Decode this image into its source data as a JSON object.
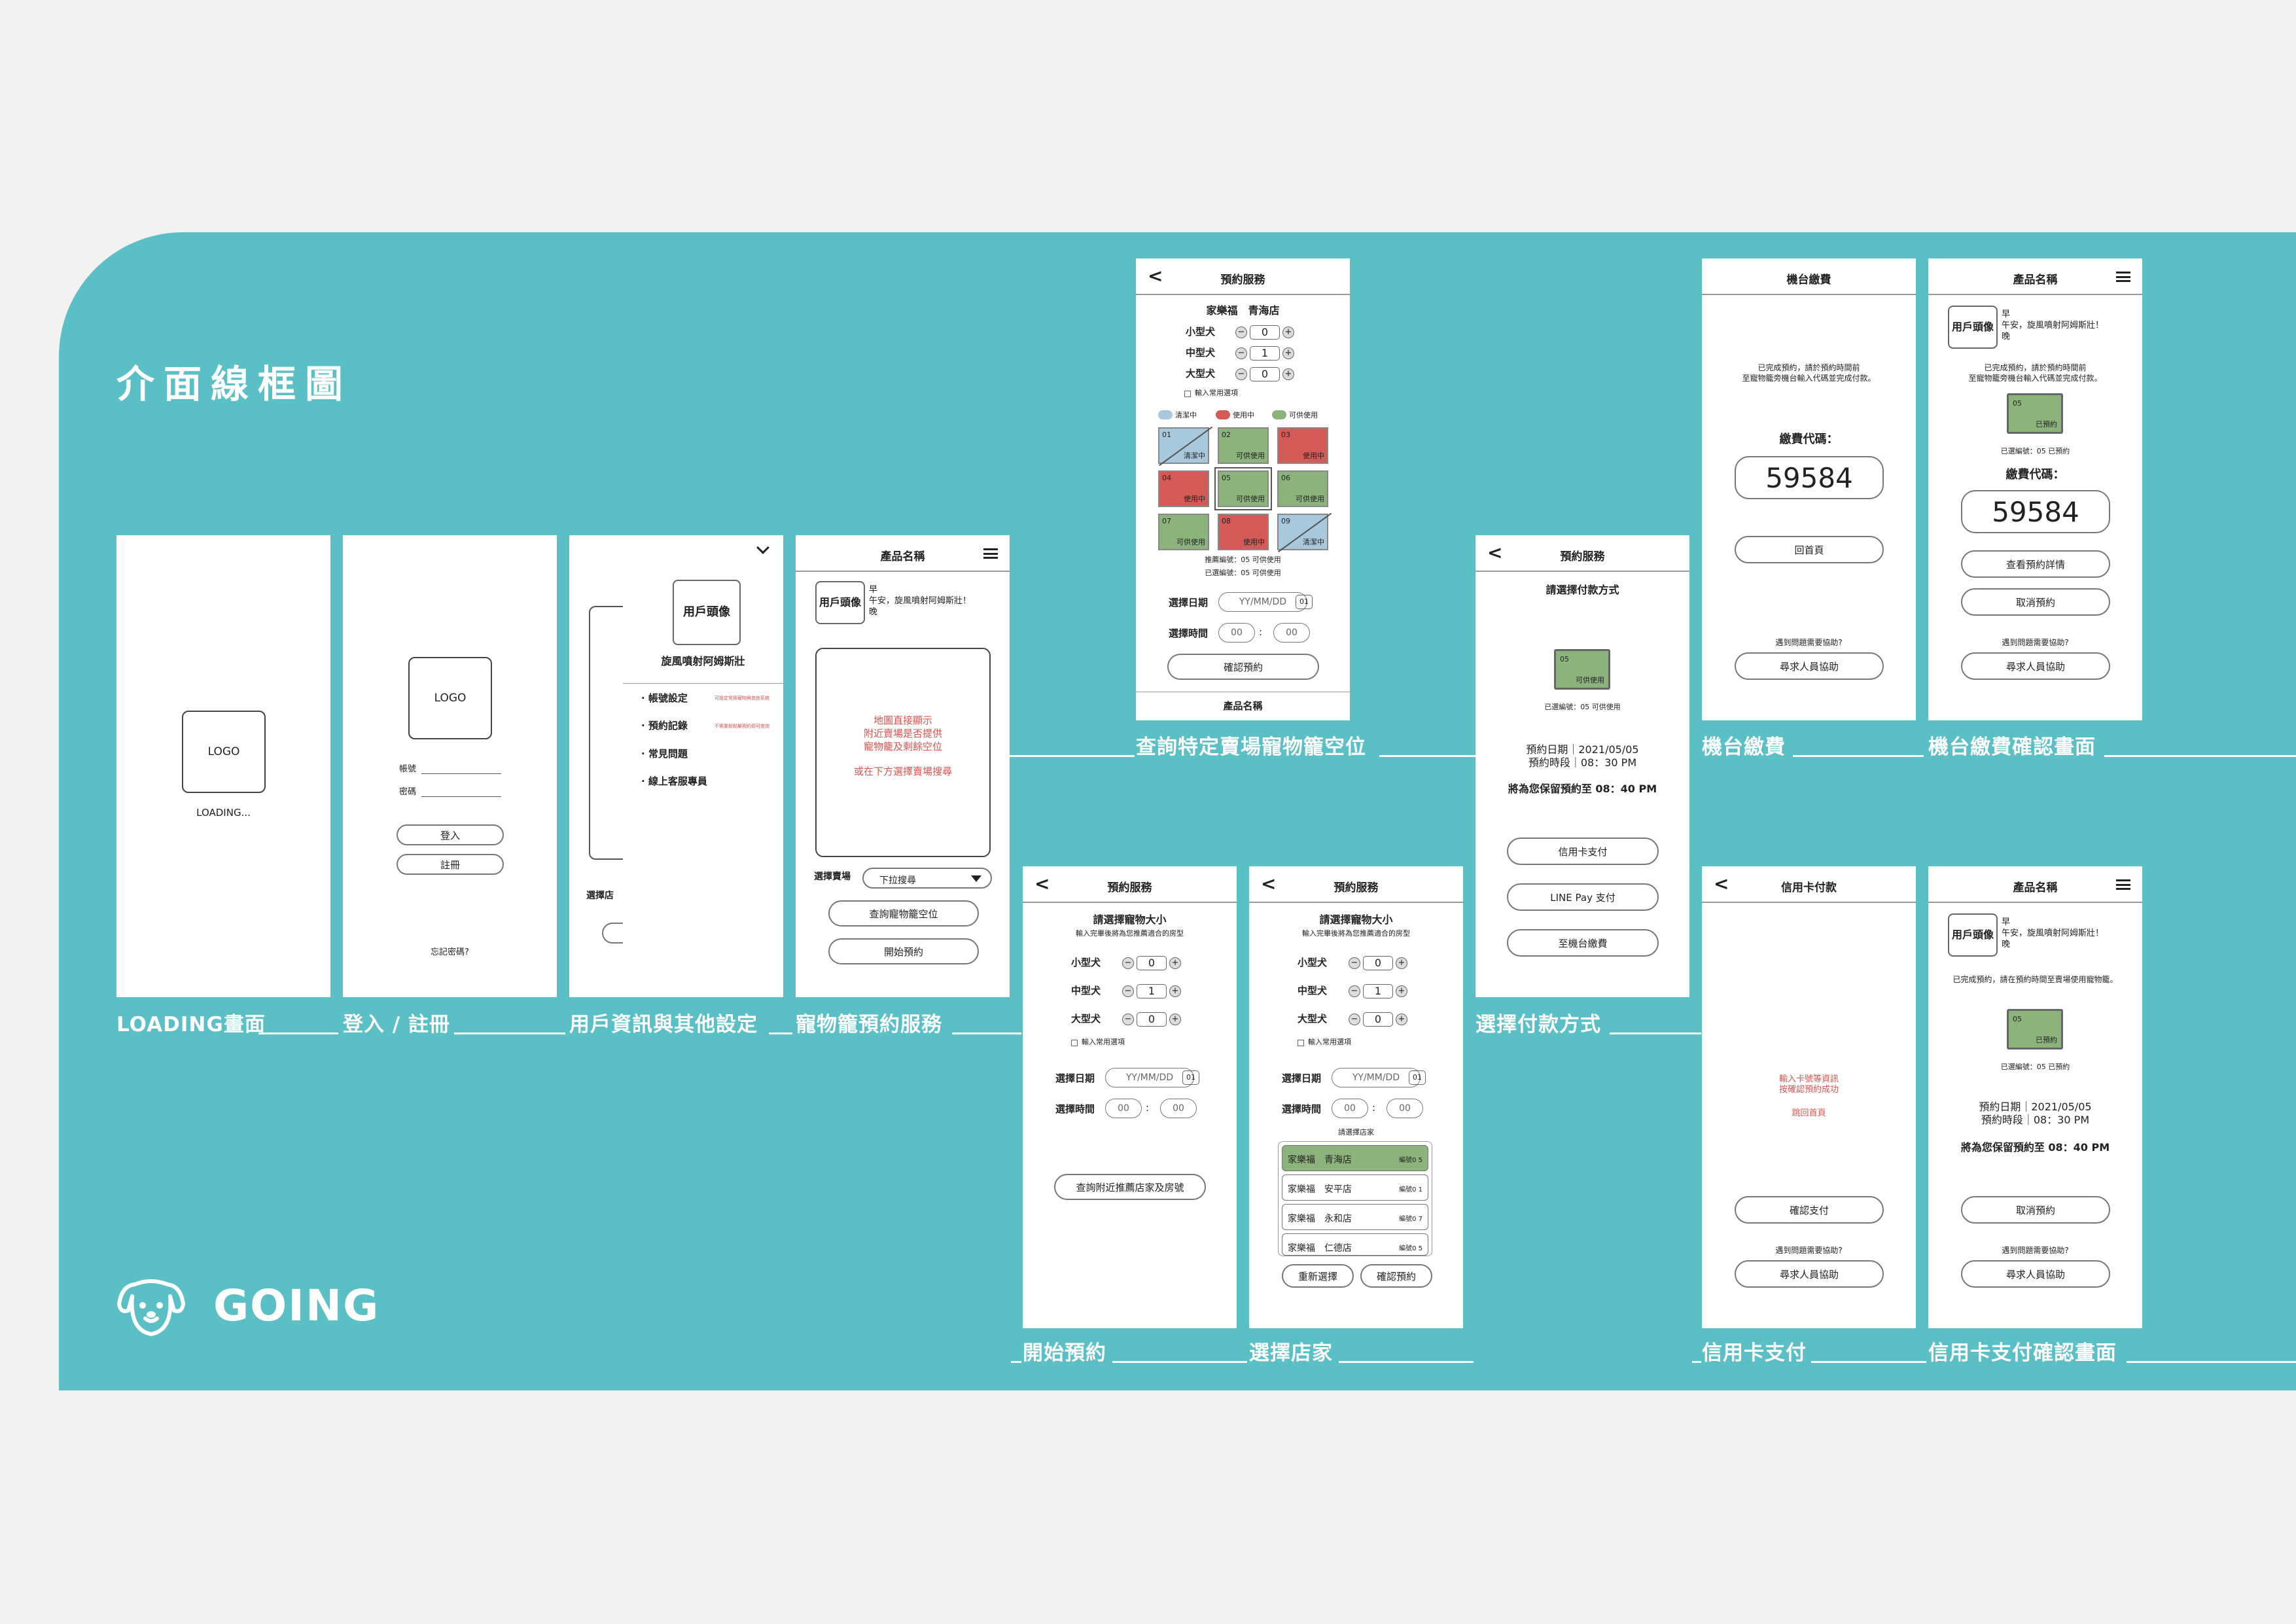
{
  "title": "介面線框圖",
  "brand": {
    "name": "GOING",
    "icon": "dog-face-icon"
  },
  "colors": {
    "band": "#5bbfc6",
    "available": "#8db37d",
    "in_use": "#d35a56",
    "cleaning": "#a8c9dd",
    "note": "#d9534f"
  },
  "labels": {
    "loading": "LOADING畫面",
    "login": "登入 / 註冊",
    "profile": "用戶資訊與其他設定",
    "service": "寵物籠預約服務",
    "query": "查詢特定賣場寵物籠空位",
    "pay_method": "選擇付款方式",
    "machine_pay": "機台繳費",
    "machine_confirm": "機台繳費確認畫面",
    "start": "開始預約",
    "select_store": "選擇店家",
    "card_pay": "信用卡支付",
    "card_confirm": "信用卡支付確認畫面"
  },
  "common": {
    "logo": "LOGO",
    "book_service": "預約服務",
    "product_name": "產品名稱",
    "need_help": "遇到問題需要協助?",
    "ask_staff": "尋求人員協助",
    "avatar": "用戶頭像",
    "greeting1": "早",
    "greeting2": "午安，旋風噴射阿姆斯壯！",
    "greeting3": "晚",
    "choose_pet_size": "請選擇寵物大小",
    "size_hint": "輸入完畢後將為您推薦適合的房型",
    "small": "小型犬",
    "medium": "中型犬",
    "large": "大型犬",
    "common_opt": "輸入常用選項",
    "date_label": "選擇日期",
    "date_placeholder": "YY/MM/DD",
    "cal": "01",
    "time_label": "選擇時間",
    "time_placeholder": "00",
    "colon": ":",
    "minus": "−",
    "plus": "+",
    "back": "<",
    "selected_cage": "已選編號：05 可供使用"
  },
  "loading": {
    "text": "LOADING..."
  },
  "login": {
    "account": "帳號",
    "password": "密碼",
    "login": "登入",
    "register": "註冊",
    "forgot": "忘記密碼?"
  },
  "profile": {
    "name": "旋風噴射阿姆斯壯",
    "menu": [
      "· 帳號設定",
      "· 預約記錄",
      "· 常見問題",
      "· 線上客服專員"
    ],
    "notes": [
      "可設定常用寵物與其他系統",
      "不需重新點擊預約即可查詢"
    ],
    "side_label": "選擇店"
  },
  "service": {
    "map_text": [
      "地圖直接顯示",
      "附近賣場是否提供",
      "寵物籠及剩餘空位"
    ],
    "map_hint": "或在下方選擇賣場搜尋",
    "store_label": "選擇賣場",
    "dropdown": "下拉搜尋",
    "query_btn": "查詢寵物籠空位",
    "start_btn": "開始預約"
  },
  "query": {
    "store": "家樂福　青海店",
    "counts": [
      "0",
      "1",
      "0"
    ],
    "legend": [
      "清潔中",
      "使用中",
      "可供使用"
    ],
    "cells": [
      {
        "n": "01",
        "s": "清潔中",
        "k": "cl"
      },
      {
        "n": "02",
        "s": "可供使用",
        "k": "av"
      },
      {
        "n": "03",
        "s": "使用中",
        "k": "use"
      },
      {
        "n": "04",
        "s": "使用中",
        "k": "use"
      },
      {
        "n": "05",
        "s": "可供使用",
        "k": "sel"
      },
      {
        "n": "06",
        "s": "可供使用",
        "k": "av"
      },
      {
        "n": "07",
        "s": "可供使用",
        "k": "av"
      },
      {
        "n": "08",
        "s": "使用中",
        "k": "use"
      },
      {
        "n": "09",
        "s": "清潔中",
        "k": "cl"
      }
    ],
    "rec": "推薦編號：05 可供使用",
    "sel": "已選編號：05 可供使用",
    "confirm": "確認預約",
    "footer": "產品名稱"
  },
  "start": {
    "counts": [
      "0",
      "1",
      "0"
    ],
    "query_btn": "查詢附近推薦店家及房號"
  },
  "select_store": {
    "counts": [
      "0",
      "1",
      "0"
    ],
    "prompt": "請選擇店家",
    "shops": [
      {
        "name": "家樂福　青海店",
        "no": "編號0 5"
      },
      {
        "name": "家樂福　安平店",
        "no": "編號0 1"
      },
      {
        "name": "家樂福　永和店",
        "no": "編號0 7"
      },
      {
        "name": "家樂福　仁德店",
        "no": "編號0 5"
      }
    ],
    "reset": "重新選擇",
    "confirm": "確認預約"
  },
  "pay_method": {
    "prompt": "請選擇付款方式",
    "cage_no": "05",
    "cage_status": "可供使用",
    "date_line": "預約日期｜2021/05/05",
    "time_line": "預約時段｜08：30 PM",
    "hold": "將為您保留預約至 08：40 PM",
    "options": [
      "信用卡支付",
      "LINE Pay 支付",
      "至機台繳費"
    ]
  },
  "machine_pay": {
    "title": "機台繳費",
    "msg1": "已完成預約，請於預約時間前",
    "msg2": "至寵物籠旁機台輸入代碼並完成付款。",
    "code_label": "繳費代碼：",
    "code": "59584",
    "home": "回首頁"
  },
  "machine_confirm": {
    "cage_no": "05",
    "cage_status": "已預約",
    "sel": "已選編號：05 已預約",
    "code_label": "繳費代碼：",
    "code": "59584",
    "detail": "查看預約詳情",
    "cancel": "取消預約"
  },
  "card_pay": {
    "title": "信用卡付款",
    "msg1": "輸入卡號等資訊",
    "msg2": "按確認預約成功",
    "home": "跳回首頁",
    "confirm": "確認支付"
  },
  "card_confirm": {
    "done": "已完成預約，請在預約時間至賣場使用寵物籠。",
    "cage_no": "05",
    "cage_status": "已預約",
    "sel": "已選編號：05 已預約",
    "date_line": "預約日期｜2021/05/05",
    "time_line": "預約時段｜08：30 PM",
    "hold": "將為您保留預約至 08：40 PM",
    "cancel": "取消預約"
  }
}
